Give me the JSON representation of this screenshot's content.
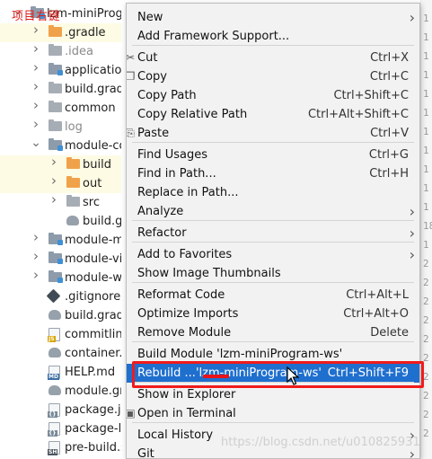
{
  "annotation": "项目右键",
  "project_tree": [
    {
      "label": "lzm-miniProgram-ws",
      "arrow": "v",
      "icon": "module-folder",
      "indent": 0,
      "selected": false
    },
    {
      "label": ".gradle",
      "arrow": ">",
      "icon": "orange-folder",
      "indent": 1,
      "selected": true
    },
    {
      "label": ".idea",
      "arrow": ">",
      "icon": "grey-folder",
      "indent": 1,
      "selected": false,
      "dim": true
    },
    {
      "label": "application-r",
      "arrow": ">",
      "icon": "module-folder",
      "indent": 1,
      "selected": false
    },
    {
      "label": "build.gradles",
      "arrow": ">",
      "icon": "grey-folder",
      "indent": 1,
      "selected": false
    },
    {
      "label": "common",
      "arrow": ">",
      "icon": "grey-folder",
      "indent": 1,
      "selected": false
    },
    {
      "label": "log",
      "arrow": ">",
      "icon": "grey-folder",
      "indent": 1,
      "selected": false,
      "dim": true
    },
    {
      "label": "module-com",
      "arrow": "v",
      "icon": "module-folder",
      "indent": 1,
      "selected": false
    },
    {
      "label": "build",
      "arrow": ">",
      "icon": "orange-folder",
      "indent": 2,
      "selected": true
    },
    {
      "label": "out",
      "arrow": ">",
      "icon": "orange-folder",
      "indent": 2,
      "selected": true
    },
    {
      "label": "src",
      "arrow": ">",
      "icon": "grey-folder",
      "indent": 2,
      "selected": false
    },
    {
      "label": "build.grad",
      "arrow": "",
      "icon": "gradle",
      "indent": 2,
      "selected": false
    },
    {
      "label": "module-mee",
      "arrow": ">",
      "icon": "module-folder",
      "indent": 1,
      "selected": false
    },
    {
      "label": "module-visito",
      "arrow": ">",
      "icon": "module-folder",
      "indent": 1,
      "selected": false
    },
    {
      "label": "module-wx-a",
      "arrow": ">",
      "icon": "module-folder",
      "indent": 1,
      "selected": false
    },
    {
      "label": ".gitignore",
      "arrow": "",
      "icon": "git",
      "indent": 1,
      "selected": false
    },
    {
      "label": "build.gradle",
      "arrow": "",
      "icon": "gradle",
      "indent": 1,
      "selected": false
    },
    {
      "label": "commitlint.co",
      "arrow": "",
      "icon": "js-file",
      "indent": 1,
      "selected": false
    },
    {
      "label": "container.gra",
      "arrow": "",
      "icon": "gradle",
      "indent": 1,
      "selected": false
    },
    {
      "label": "HELP.md",
      "arrow": "",
      "icon": "md-file",
      "indent": 1,
      "selected": false
    },
    {
      "label": "module.grad",
      "arrow": "",
      "icon": "gradle",
      "indent": 1,
      "selected": false
    },
    {
      "label": "package.json",
      "arrow": "",
      "icon": "json-file",
      "indent": 1,
      "selected": false
    },
    {
      "label": "package-lock",
      "arrow": "",
      "icon": "json-file",
      "indent": 1,
      "selected": false
    },
    {
      "label": "pre-build.sh",
      "arrow": "",
      "icon": "sh-file",
      "indent": 1,
      "selected": false
    }
  ],
  "gutter_numbers": [
    "1",
    "1",
    "1",
    "1",
    "1",
    "1",
    "1",
    "1",
    "1",
    "1",
    "1",
    "18",
    "1",
    "2",
    "2",
    "2",
    "2",
    "2",
    "2",
    "2",
    "2",
    "2",
    "2"
  ],
  "menu": {
    "items": [
      {
        "label": "New",
        "shortcut": "",
        "submenu": true
      },
      {
        "label": "Add Framework Support...",
        "shortcut": "",
        "submenu": false
      },
      {
        "label": "Cut",
        "shortcut": "Ctrl+X",
        "submenu": false,
        "icon": "scissors-icon"
      },
      {
        "label": "Copy",
        "shortcut": "Ctrl+C",
        "submenu": false,
        "icon": "copy-icon"
      },
      {
        "label": "Copy Path",
        "shortcut": "Ctrl+Shift+C",
        "submenu": false
      },
      {
        "label": "Copy Relative Path",
        "shortcut": "Ctrl+Alt+Shift+C",
        "submenu": false
      },
      {
        "label": "Paste",
        "shortcut": "Ctrl+V",
        "submenu": false,
        "icon": "paste-icon"
      },
      {
        "label": "Find Usages",
        "shortcut": "Ctrl+G",
        "submenu": false
      },
      {
        "label": "Find in Path...",
        "shortcut": "Ctrl+H",
        "submenu": false
      },
      {
        "label": "Replace in Path...",
        "shortcut": "",
        "submenu": false
      },
      {
        "label": "Analyze",
        "shortcut": "",
        "submenu": true
      },
      {
        "label": "Refactor",
        "shortcut": "",
        "submenu": true
      },
      {
        "label": "Add to Favorites",
        "shortcut": "",
        "submenu": true
      },
      {
        "label": "Show Image Thumbnails",
        "shortcut": "",
        "submenu": false
      },
      {
        "label": "Reformat Code",
        "shortcut": "Ctrl+Alt+L",
        "submenu": false
      },
      {
        "label": "Optimize Imports",
        "shortcut": "Ctrl+Alt+O",
        "submenu": false
      },
      {
        "label": "Remove Module",
        "shortcut": "Delete",
        "submenu": false
      },
      {
        "label": "Build Module 'lzm-miniProgram-ws'",
        "shortcut": "",
        "submenu": false
      },
      {
        "label": "Rebuild ...'lzm-miniProgram-ws'",
        "shortcut": "Ctrl+Shift+F9",
        "submenu": false,
        "active": true
      },
      {
        "label": "Show in Explorer",
        "shortcut": "",
        "submenu": false
      },
      {
        "label": "Open in Terminal",
        "shortcut": "",
        "submenu": false,
        "icon": "terminal-icon"
      },
      {
        "label": "Local History",
        "shortcut": "",
        "submenu": true
      },
      {
        "label": "Git",
        "shortcut": "",
        "submenu": true
      }
    ]
  },
  "watermark": "https://blog.csdn.net/u010825931",
  "colors": {
    "menu_bg": "#f2f2f2",
    "active_bg": "#1f6fce",
    "highlight_box": "#f01b1b",
    "annotation": "#e0201d",
    "selected_row": "#fdfbe3"
  }
}
